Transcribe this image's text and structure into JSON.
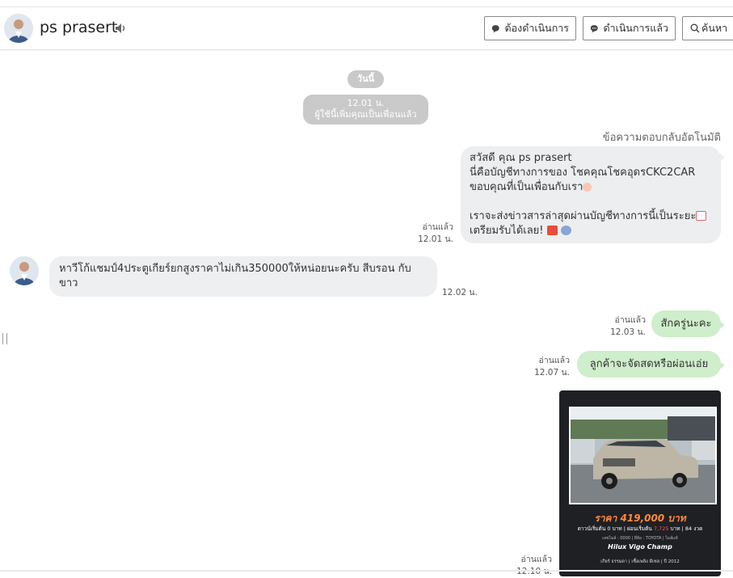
{
  "header": {
    "contact_name": "ps prasert",
    "buttons": {
      "pending": "ต้องดำเนินการ",
      "done": "ดำเนินการแล้ว",
      "search": "ค้นหา"
    }
  },
  "chat": {
    "date_pill": "วันนี้",
    "system_time": "12.01 น.",
    "system_text": "ผู้ใช้นี้เพิ่มคุณเป็นเพื่อนแล้ว",
    "auto_reply_label": "ข้อความตอบกลับอัตโนมัติ",
    "auto_reply": {
      "line1": "สวัสดี คุณ ps prasert",
      "line2": "นี่คือบัญชีทางการของ โชคคุณโชคอุดรCKC2CAR",
      "line3": "ขอบคุณที่เป็นเพื่อนกับเรา",
      "line4": "เราจะส่งข่าวสารล่าสุดผ่านบัญชีทางการนี้เป็นระยะ",
      "line5": "เตรียมรับได้เลย!"
    },
    "read_label": "อ่านแล้ว",
    "auto_reply_time": "12.01 น.",
    "incoming_text": "หาวีโก้แชมป์4ประตูเกียร์ยกสูงราคาไม่เกิน350000ให้หน่อยนะครับ  สีบรอน กับ ขาว",
    "incoming_time": "12.02 น.",
    "reply1_text": "สักครู่นะคะ",
    "reply1_time": "12.03 น.",
    "reply2_text": "ลูกค้าจะจัดสดหรือผ่อนเอ่ย",
    "reply2_time": "12.07 น.",
    "card_time": "12.10 น.",
    "card": {
      "price": "ราคา 419,000 บาท",
      "terms_prefix": "ดาวน์เริ่มต้น 0 บาท | ผ่อนเริ่มต้น ",
      "terms_amount": "7,725",
      "terms_suffix": " บาท | 84 งวด",
      "info": "เลขไมล์ : 0000 | ยี่ห้อ : TOYOTA | ไมล์แท้",
      "model": "Hilux Vigo Champ",
      "footer": "เกียร์ ธรรมดา  |  เชื้อเพลิง ดีเซล  |  ปี 2012"
    }
  },
  "colors": {
    "green_bubble": "#cfeecb",
    "grey_bubble": "#eceef0",
    "pill": "#c9c9c9",
    "card_bg": "#1f2023",
    "price": "#ff8a3d"
  }
}
